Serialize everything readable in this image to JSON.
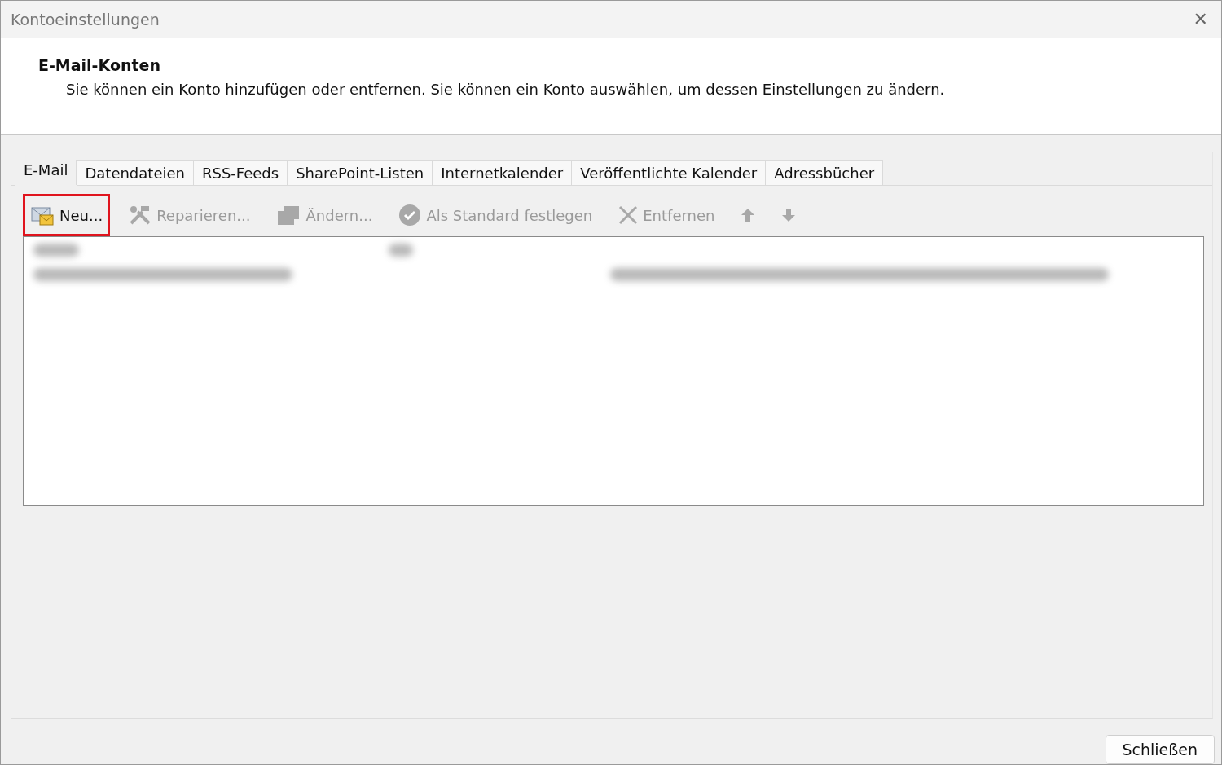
{
  "window": {
    "title": "Kontoeinstellungen",
    "close": "✕"
  },
  "header": {
    "title": "E-Mail-Konten",
    "description": "Sie können ein Konto hinzufügen oder entfernen. Sie können ein Konto auswählen, um dessen Einstellungen zu ändern."
  },
  "tabs": [
    {
      "label": "E-Mail",
      "selected": true
    },
    {
      "label": "Datendateien",
      "selected": false
    },
    {
      "label": "RSS-Feeds",
      "selected": false
    },
    {
      "label": "SharePoint-Listen",
      "selected": false
    },
    {
      "label": "Internetkalender",
      "selected": false
    },
    {
      "label": "Veröffentlichte Kalender",
      "selected": false
    },
    {
      "label": "Adressbücher",
      "selected": false
    }
  ],
  "toolbar": [
    {
      "kind": "new",
      "label": "Neu...",
      "disabled": false,
      "highlighted": true
    },
    {
      "kind": "repair",
      "label": "Reparieren...",
      "disabled": true,
      "highlighted": false
    },
    {
      "kind": "change",
      "label": "Ändern...",
      "disabled": true,
      "highlighted": false
    },
    {
      "kind": "default",
      "label": "Als Standard festlegen",
      "disabled": true,
      "highlighted": false
    },
    {
      "kind": "remove",
      "label": "Entfernen",
      "disabled": true,
      "highlighted": false
    },
    {
      "kind": "up",
      "disabled": true,
      "highlighted": false
    },
    {
      "kind": "down",
      "disabled": true,
      "highlighted": false
    }
  ],
  "buttons": [
    "Schließen"
  ]
}
